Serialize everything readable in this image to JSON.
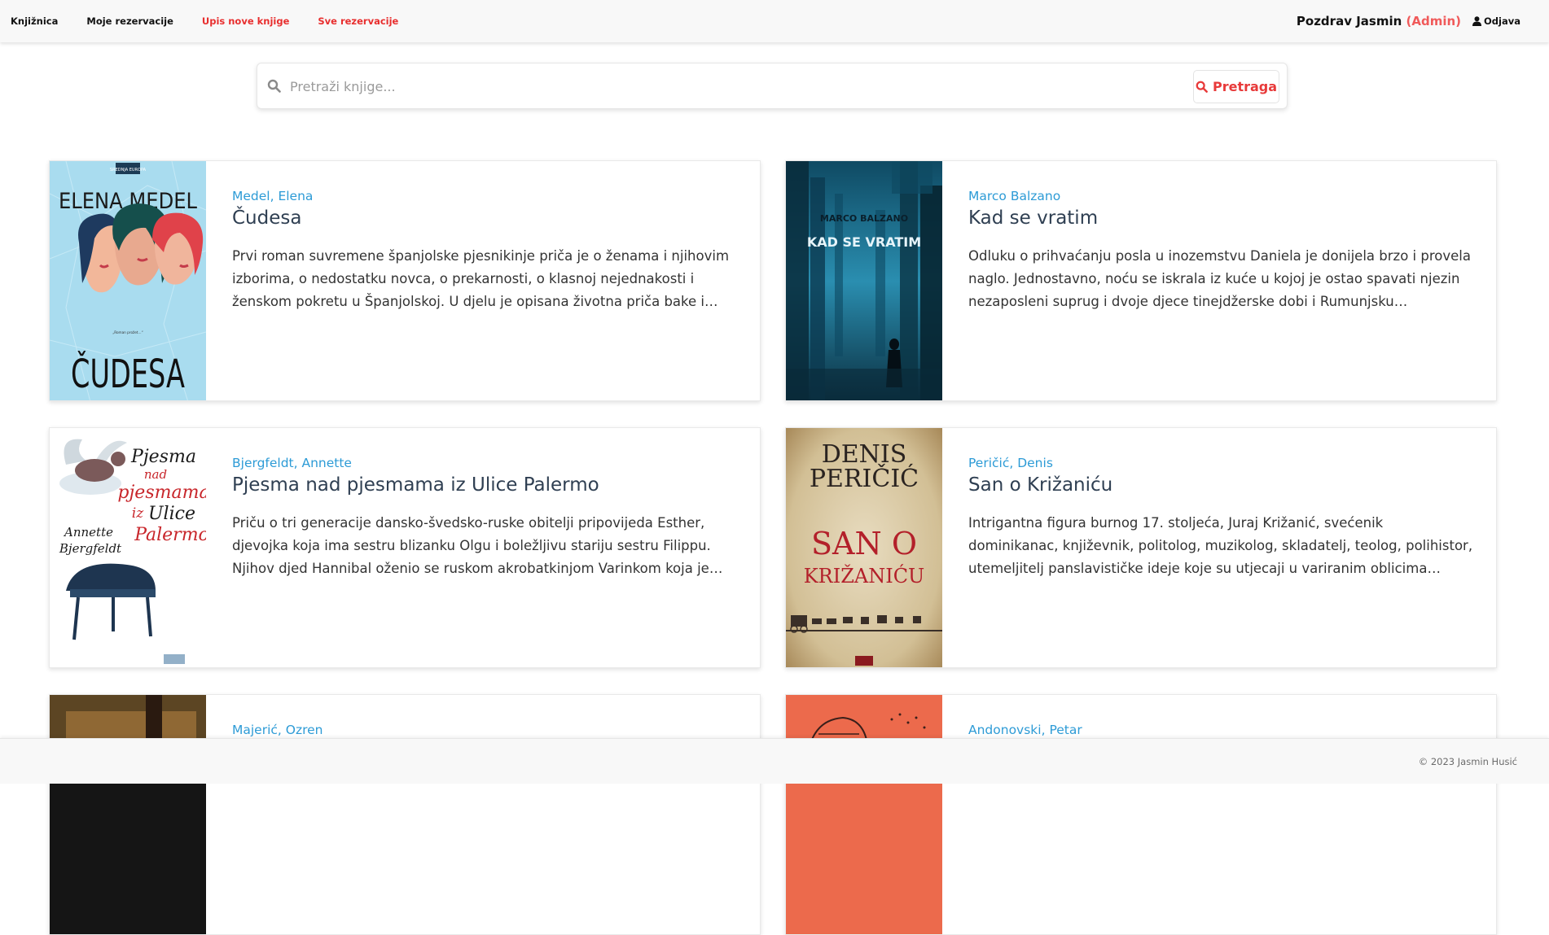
{
  "nav": {
    "items": [
      {
        "label": "Knjižnica"
      },
      {
        "label": "Moje rezervacije"
      },
      {
        "label": "Upis nove knjige"
      },
      {
        "label": "Sve rezervacije"
      }
    ],
    "greeting": "Pozdrav Jasmin",
    "role": "(Admin)",
    "logout": "Odjava"
  },
  "search": {
    "placeholder": "Pretraži knjige...",
    "button": "Pretraga"
  },
  "books": [
    {
      "author": "Medel, Elena",
      "title": "Čudesa",
      "description": "Prvi roman suvremene španjolske pjesnikinje priča je o ženama i njihovim izborima, o nedostatku novca, o prekarnosti, o klasnoj nejednakosti i ženskom pokretu u Španjolskoj. U djelu je opisana životna priča bake i unuke, koje su…",
      "cover": {
        "top_text": "ELENA MEDEL",
        "bottom_text": "ČUDESA",
        "small_text": "„Roman prožet…“",
        "publisher": "SREDNJA EUROPA",
        "bg": "#a9dcef"
      }
    },
    {
      "author": "Marco Balzano",
      "title": "Kad se vratim",
      "description": "Odluku o prihvaćanju posla u inozemstvu Daniela je donijela brzo i provela naglo. Jednostavno, noću se iskrala iz kuće u kojoj je ostao spavati njezin nezaposleni suprug i dvoje djece tinejdžerske dobi i Rumunjsku zamijenila…",
      "cover": {
        "top_text": "MARCO BALZANO",
        "bottom_text": "KAD SE VRATIM",
        "bg": "#1a6b8a"
      }
    },
    {
      "author": "Bjergfeldt, Annette",
      "title": "Pjesma nad pjesmama iz Ulice Palermo",
      "description": "Priču o tri generacije dansko-švedsko-ruske obitelji pripovijeda Esther, djevojka koja ima sestru blizanku Olgu i boležljivu stariju sestru Filippu. Njihov djed Hannibal oženio se ruskom akrobatkinjom Varinkom koja je…",
      "cover": {
        "line1": "Pjesma",
        "line2": "nad",
        "line3": "pjesmama",
        "line4": "iz",
        "line5": "Ulice",
        "line6": "Palermo",
        "author1": "Annette",
        "author2": "Bjergfeldt",
        "bg": "#ffffff"
      }
    },
    {
      "author": "Peričić, Denis",
      "title": "San o Križaniću",
      "description": "Intrigantna figura burnog 17. stoljeća, Juraj Križanić, svećenik dominikanac, književnik, politolog, muzikolog, skladatelj, teolog, polihistor, utemeljitelj panslavističke ideje koje su utjecaji u variranim oblicima prisutni i danas, te…",
      "cover": {
        "line1": "DENIS",
        "line2": "PERIČIĆ",
        "line3": "SAN O",
        "line4": "KRIŽANIĆU",
        "bg": "#d9c9a3"
      }
    },
    {
      "author": "Majerić, Ozren",
      "title": "",
      "description": "",
      "cover": {
        "bg": "#1a1a1a"
      }
    },
    {
      "author": "Andonovski, Petar",
      "title": "",
      "description": "",
      "cover": {
        "bg": "#ec6a4c"
      }
    }
  ],
  "footer": {
    "copyright": "© 2023 Jasmin Husić"
  }
}
